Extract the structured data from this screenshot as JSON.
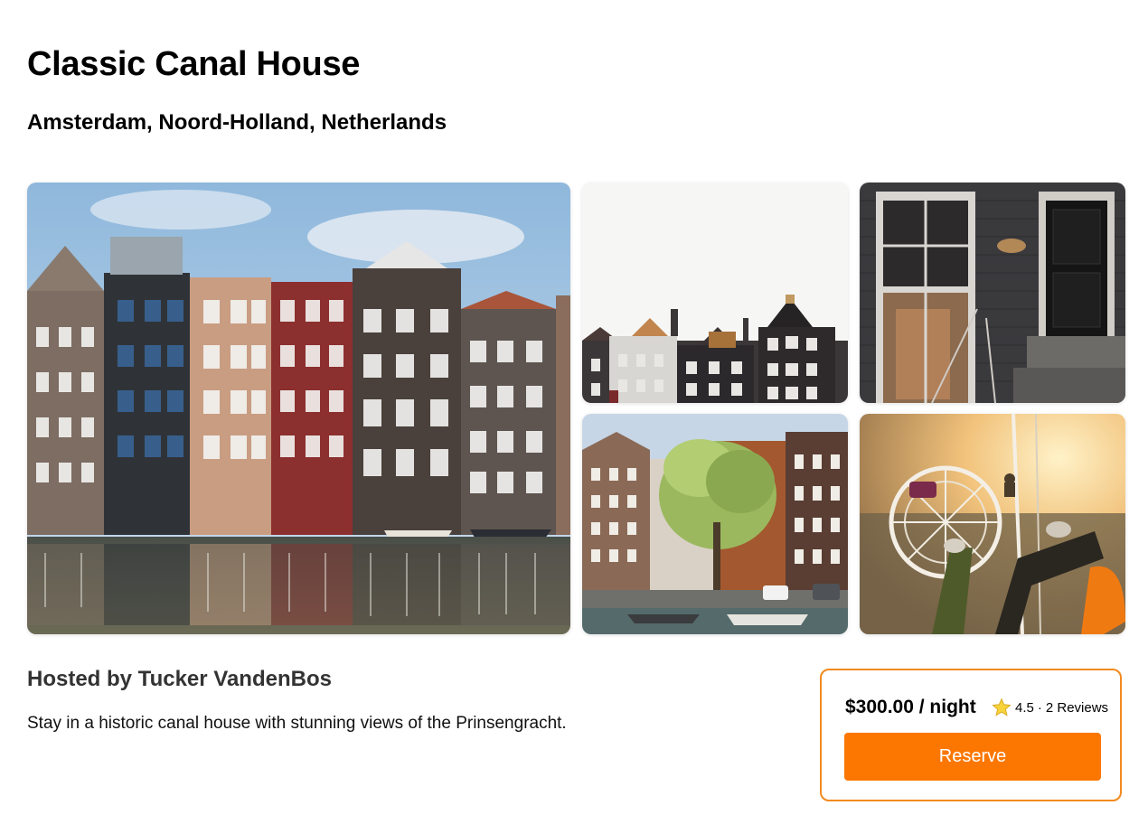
{
  "listing": {
    "title": "Classic Canal House",
    "location": "Amsterdam, Noord-Holland, Netherlands",
    "host": "Hosted by Tucker VandenBos",
    "description": "Stay in a historic canal house with stunning views of the Prinsengracht."
  },
  "photos": [
    "canal-houses-reflection",
    "gabled-rooftops",
    "brick-doorway",
    "tree-lined-canal-street",
    "swing-ride-view"
  ],
  "booking": {
    "price": "$300.00 / night",
    "rating": "4.5",
    "separator": "·",
    "reviews": "2 Reviews",
    "reserve_label": "Reserve"
  },
  "colors": {
    "accent": "#fb7702",
    "card_border": "#f28a1e",
    "star": "#f5c518"
  }
}
